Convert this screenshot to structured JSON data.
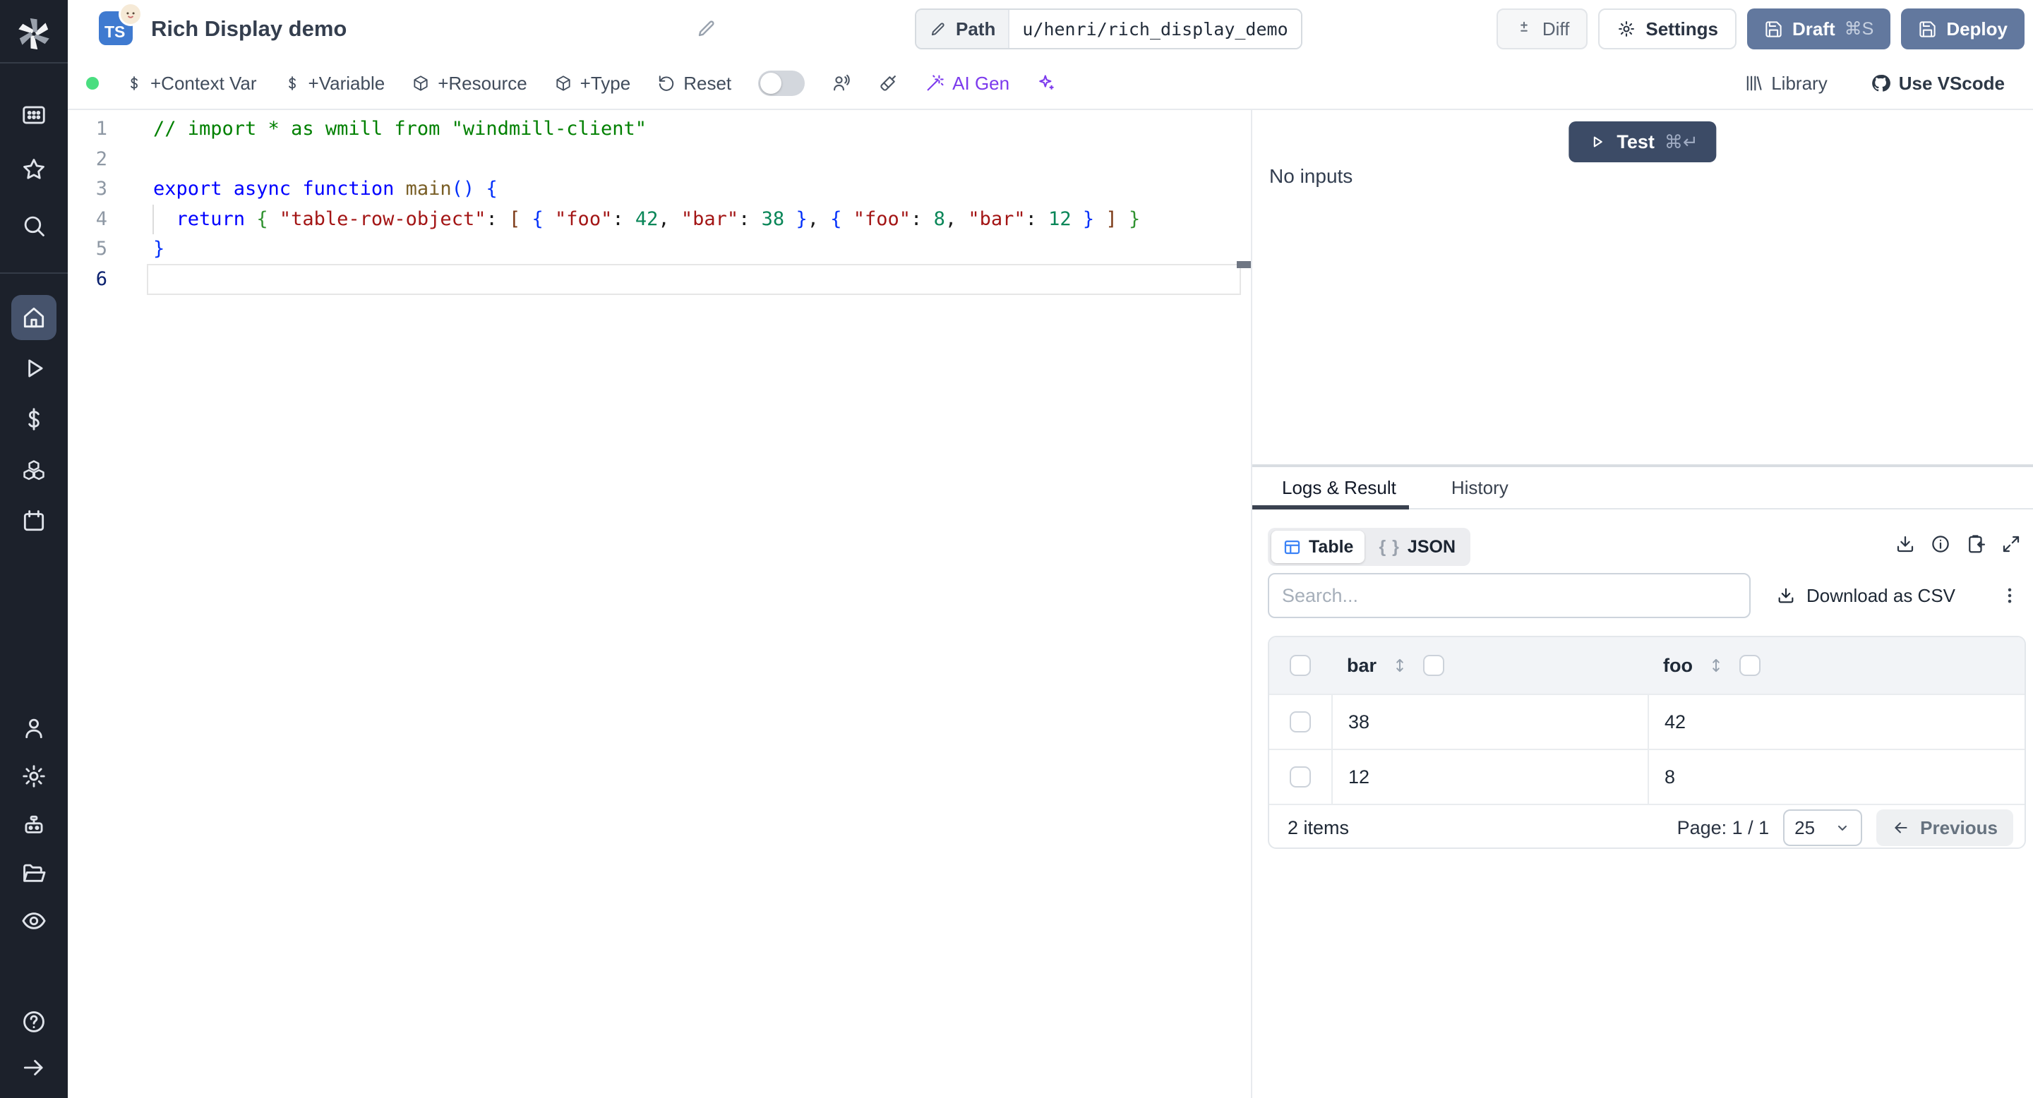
{
  "colors": {
    "sidebar_bg": "#1c212b",
    "sidebar_active": "#46536c",
    "primary_button": "#62789e",
    "test_button": "#3c4b66",
    "ai_accent": "#7c3aed",
    "ts_badge_blue": "#3f7ad0",
    "status_green": "#4ade80",
    "table_icon_blue": "#3b82f6"
  },
  "header": {
    "lang_badge": "TS",
    "title": "Rich Display demo",
    "path_label": "Path",
    "path_value": "u/henri/rich_display_demo",
    "diff_label": "Diff",
    "settings_label": "Settings",
    "draft_label": "Draft",
    "draft_kbd": "⌘S",
    "deploy_label": "Deploy"
  },
  "toolbar": {
    "items": [
      "+Context Var",
      "+Variable",
      "+Resource",
      "+Type",
      "Reset"
    ],
    "ai_gen_label": "AI Gen",
    "library_label": "Library",
    "vscode_label": "Use VScode"
  },
  "editor": {
    "active_line": "6",
    "lines": [
      {
        "num": "1",
        "tokens": [
          [
            "cmt",
            "// import * as wmill from \"windmill-client\""
          ]
        ]
      },
      {
        "num": "2",
        "tokens": []
      },
      {
        "num": "3",
        "tokens": [
          [
            "kw",
            "export async function "
          ],
          [
            "fn",
            "main"
          ],
          [
            "b1",
            "()"
          ],
          [
            "pl",
            " "
          ],
          [
            "b1",
            "{"
          ]
        ]
      },
      {
        "num": "4",
        "tokens": [
          [
            "pl",
            "  "
          ],
          [
            "kw",
            "return"
          ],
          [
            "pl",
            " "
          ],
          [
            "b2",
            "{"
          ],
          [
            "pl",
            " "
          ],
          [
            "str",
            "\"table-row-object\""
          ],
          [
            "pl",
            ": "
          ],
          [
            "b3",
            "["
          ],
          [
            "pl",
            " "
          ],
          [
            "b1",
            "{"
          ],
          [
            "pl",
            " "
          ],
          [
            "str",
            "\"foo\""
          ],
          [
            "pl",
            ": "
          ],
          [
            "num",
            "42"
          ],
          [
            "pl",
            ", "
          ],
          [
            "str",
            "\"bar\""
          ],
          [
            "pl",
            ": "
          ],
          [
            "num",
            "38"
          ],
          [
            "pl",
            " "
          ],
          [
            "b1",
            "}"
          ],
          [
            "pl",
            ", "
          ],
          [
            "b1",
            "{"
          ],
          [
            "pl",
            " "
          ],
          [
            "str",
            "\"foo\""
          ],
          [
            "pl",
            ": "
          ],
          [
            "num",
            "8"
          ],
          [
            "pl",
            ", "
          ],
          [
            "str",
            "\"bar\""
          ],
          [
            "pl",
            ": "
          ],
          [
            "num",
            "12"
          ],
          [
            "pl",
            " "
          ],
          [
            "b1",
            "}"
          ],
          [
            "pl",
            " "
          ],
          [
            "b3",
            "]"
          ],
          [
            "pl",
            " "
          ],
          [
            "b2",
            "}"
          ]
        ]
      },
      {
        "num": "5",
        "tokens": [
          [
            "b1",
            "}"
          ]
        ]
      },
      {
        "num": "6",
        "tokens": []
      }
    ]
  },
  "run_panel": {
    "test_label": "Test",
    "test_kbd": "⌘↵",
    "no_inputs": "No inputs"
  },
  "result_panel": {
    "tabs": [
      "Logs & Result",
      "History"
    ],
    "active_tab": "Logs & Result",
    "views": [
      "Table",
      "JSON"
    ],
    "active_view": "Table",
    "search_placeholder": "Search...",
    "download_csv_label": "Download as CSV",
    "table": {
      "columns": [
        "bar",
        "foo"
      ],
      "rows": [
        [
          "38",
          "42"
        ],
        [
          "12",
          "8"
        ]
      ],
      "items_label": "2 items",
      "page_label": "Page: 1 / 1",
      "page_size": "25",
      "previous_label": "Previous"
    }
  }
}
